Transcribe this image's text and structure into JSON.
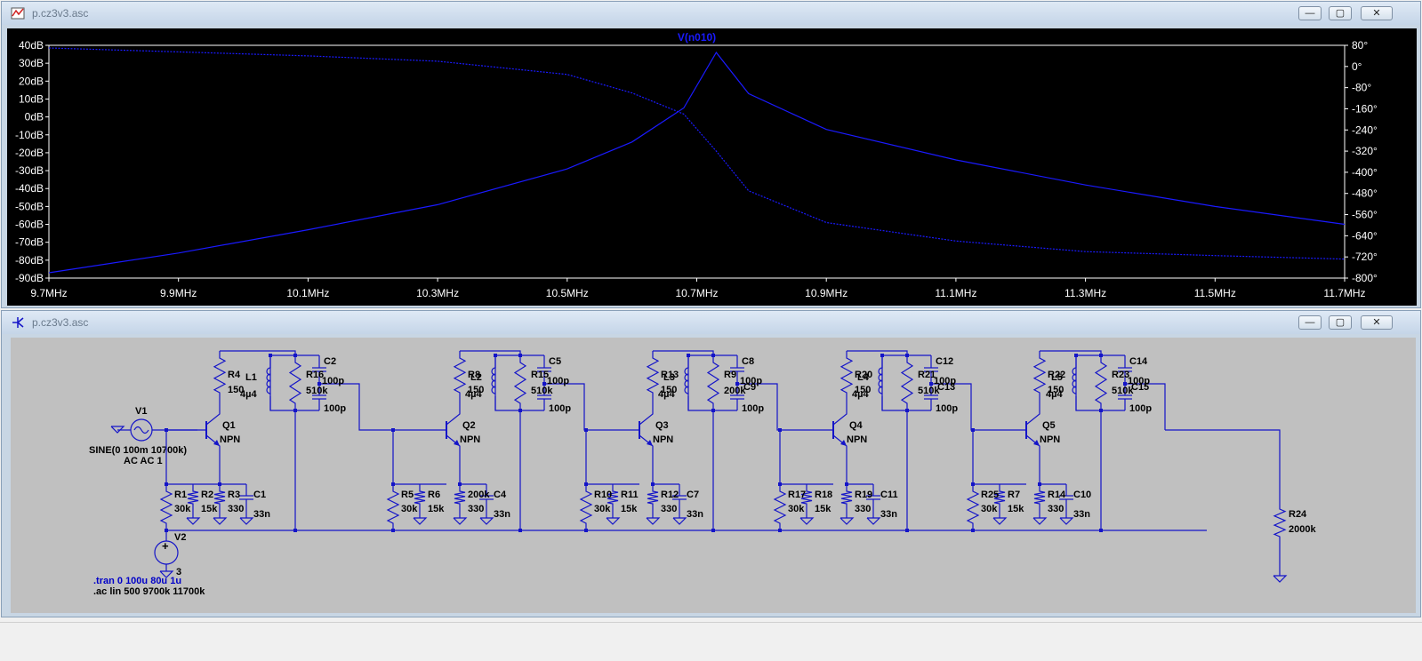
{
  "waveform_window": {
    "title": "p.cz3v3.asc",
    "trace_label": "V(n010)",
    "left_ticks": [
      "40dB",
      "30dB",
      "20dB",
      "10dB",
      "0dB",
      "-10dB",
      "-20dB",
      "-30dB",
      "-40dB",
      "-50dB",
      "-60dB",
      "-70dB",
      "-80dB",
      "-90dB"
    ],
    "right_ticks": [
      "80°",
      "0°",
      "-80°",
      "-160°",
      "-240°",
      "-320°",
      "-400°",
      "-480°",
      "-560°",
      "-640°",
      "-720°",
      "-800°"
    ],
    "x_ticks": [
      "9.7MHz",
      "9.9MHz",
      "10.1MHz",
      "10.3MHz",
      "10.5MHz",
      "10.7MHz",
      "10.9MHz",
      "11.1MHz",
      "11.3MHz",
      "11.5MHz",
      "11.7MHz"
    ],
    "controls": {
      "minimize": "—",
      "maximize": "▢",
      "close": "✕"
    }
  },
  "schematic_window": {
    "title": "p.cz3v3.asc",
    "controls": {
      "minimize": "—",
      "maximize": "▢",
      "close": "✕"
    },
    "source": {
      "name": "V1",
      "value1": "SINE(0 100m 10700k)",
      "value2": "AC AC 1"
    },
    "supply": {
      "name": "V2",
      "value": "3"
    },
    "directives": [
      ".tran 0 100u 80u 1u",
      ".ac lin 500 9700k 11700k"
    ],
    "load": {
      "name": "R24",
      "value": "2000k"
    },
    "stages": [
      {
        "q": "Q1",
        "qtype": "NPN",
        "rc": "R4",
        "rcv": "150",
        "l": "L1",
        "lv": "4µ4",
        "rp": "R16",
        "rpv": "510k",
        "ct": "C2",
        "ctv": "100p",
        "cc": "",
        "ccv": "100p",
        "rb1": "R1",
        "rb1v": "30k",
        "rb2": "R2",
        "rb2v": "15k",
        "re": "R3",
        "rev": "330",
        "ce": "C1",
        "cev": "33n"
      },
      {
        "q": "Q2",
        "qtype": "NPN",
        "rc": "R8",
        "rcv": "150",
        "l": "L2",
        "lv": "4µ4",
        "rp": "R15",
        "rpv": "510k",
        "ct": "C5",
        "ctv": "100p",
        "cc": "",
        "ccv": "100p",
        "rb1": "R5",
        "rb1v": "30k",
        "rb2": "R6",
        "rb2v": "15k",
        "re": "200k",
        "rev": "330",
        "ce": "C4",
        "cev": "33n"
      },
      {
        "q": "Q3",
        "qtype": "NPN",
        "rc": "R13",
        "rcv": "150",
        "l": "L3",
        "lv": "4µ4",
        "rp": "R9",
        "rpv": "200k",
        "ct": "C8",
        "ctv": "100p",
        "cc": "C9",
        "ccv": "100p",
        "rb1": "R10",
        "rb1v": "30k",
        "rb2": "R11",
        "rb2v": "15k",
        "re": "R12",
        "rev": "330",
        "ce": "C7",
        "cev": "33n"
      },
      {
        "q": "Q4",
        "qtype": "NPN",
        "rc": "R20",
        "rcv": "150",
        "l": "L4",
        "lv": "4µ4",
        "rp": "R21",
        "rpv": "510k",
        "ct": "C12",
        "ctv": "100p",
        "cc": "C13",
        "ccv": "100p",
        "rb1": "R17",
        "rb1v": "30k",
        "rb2": "R18",
        "rb2v": "15k",
        "re": "R19",
        "rev": "330",
        "ce": "C11",
        "cev": "33n"
      },
      {
        "q": "Q5",
        "qtype": "NPN",
        "rc": "R22",
        "rcv": "150",
        "l": "L5",
        "lv": "4µ4",
        "rp": "R23",
        "rpv": "510k",
        "ct": "C14",
        "ctv": "100p",
        "cc": "C15",
        "ccv": "100p",
        "rb1": "R25",
        "rb1v": "30k",
        "rb2": "R7",
        "rb2v": "15k",
        "re": "R14",
        "rev": "330",
        "ce": "C10",
        "cev": "33n"
      }
    ]
  },
  "colors": {
    "trace": "#1a1aff",
    "wire": "#1414c8",
    "plot_bg": "#000000",
    "schem_bg": "#c0c0c0",
    "axis_text": "#ffffff"
  },
  "chart_data": {
    "type": "line",
    "title": "V(n010)",
    "xlabel": "",
    "ylabel": "",
    "y2label": "",
    "x_unit": "MHz",
    "xlim": [
      9.7,
      11.7
    ],
    "ylim": [
      -90,
      40
    ],
    "y2lim": [
      -800,
      80
    ],
    "x": [
      9.7,
      9.9,
      10.1,
      10.3,
      10.5,
      10.6,
      10.68,
      10.73,
      10.78,
      10.9,
      11.1,
      11.3,
      11.5,
      11.7
    ],
    "series": [
      {
        "name": "",
        "axis": "left",
        "style": "solid",
        "values": [
          -87,
          -76,
          -63,
          -49,
          -29,
          -14,
          5,
          36,
          13,
          -7,
          -24,
          -38,
          -50,
          -60
        ]
      },
      {
        "name": "",
        "axis": "right",
        "style": "dotted",
        "values": [
          70,
          55,
          40,
          20,
          -30,
          -100,
          -180,
          -320,
          -470,
          -590,
          -660,
          -700,
          -715,
          -728
        ]
      }
    ],
    "grid": false,
    "legend": "none"
  }
}
